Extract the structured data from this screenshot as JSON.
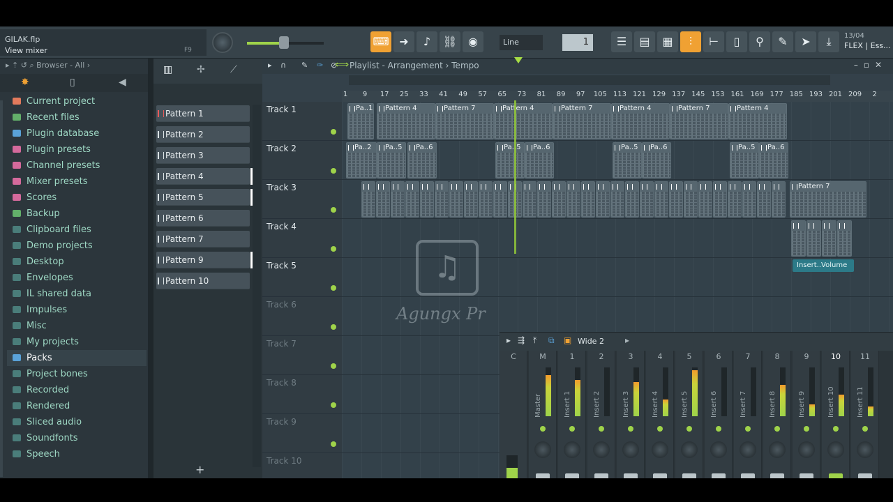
{
  "topbar": {
    "file_name": "GILAK.flp",
    "hint": "View mixer",
    "hint_key": "F9",
    "snap_mode": "Line",
    "step_value": "1",
    "info_line1": "13/04",
    "info_line2": "FLEX | Ess..."
  },
  "browser": {
    "header": "Browser - All",
    "items": [
      {
        "label": "Current project",
        "color": "#e27a5c",
        "selected": false
      },
      {
        "label": "Recent files",
        "color": "#63b06a",
        "selected": false
      },
      {
        "label": "Plugin database",
        "color": "#5aa2d8",
        "selected": false
      },
      {
        "label": "Plugin presets",
        "color": "#d46a9c",
        "selected": false
      },
      {
        "label": "Channel presets",
        "color": "#d46a9c",
        "selected": false
      },
      {
        "label": "Mixer presets",
        "color": "#d46a9c",
        "selected": false
      },
      {
        "label": "Scores",
        "color": "#d46a9c",
        "selected": false
      },
      {
        "label": "Backup",
        "color": "#63b06a",
        "selected": false
      },
      {
        "label": "Clipboard files",
        "color": "#4a7d7a",
        "selected": false
      },
      {
        "label": "Demo projects",
        "color": "#4a7d7a",
        "selected": false
      },
      {
        "label": "Desktop",
        "color": "#4a7d7a",
        "selected": false
      },
      {
        "label": "Envelopes",
        "color": "#4a7d7a",
        "selected": false
      },
      {
        "label": "IL shared data",
        "color": "#4a7d7a",
        "selected": false
      },
      {
        "label": "Impulses",
        "color": "#4a7d7a",
        "selected": false
      },
      {
        "label": "Misc",
        "color": "#4a7d7a",
        "selected": false
      },
      {
        "label": "My projects",
        "color": "#4a7d7a",
        "selected": false
      },
      {
        "label": "Packs",
        "color": "#5aa2d8",
        "selected": true
      },
      {
        "label": "Project bones",
        "color": "#4a7d7a",
        "selected": false
      },
      {
        "label": "Recorded",
        "color": "#4a7d7a",
        "selected": false
      },
      {
        "label": "Rendered",
        "color": "#4a7d7a",
        "selected": false
      },
      {
        "label": "Sliced audio",
        "color": "#4a7d7a",
        "selected": false
      },
      {
        "label": "Soundfonts",
        "color": "#4a7d7a",
        "selected": false
      },
      {
        "label": "Speech",
        "color": "#4a7d7a",
        "selected": false
      }
    ]
  },
  "patterns": [
    {
      "label": "Pattern 1",
      "active": false,
      "current": true
    },
    {
      "label": "Pattern 2",
      "active": false,
      "current": false
    },
    {
      "label": "Pattern 3",
      "active": false,
      "current": false
    },
    {
      "label": "Pattern 4",
      "active": true,
      "current": false
    },
    {
      "label": "Pattern 5",
      "active": true,
      "current": false
    },
    {
      "label": "Pattern 6",
      "active": false,
      "current": false
    },
    {
      "label": "Pattern 7",
      "active": false,
      "current": false
    },
    {
      "label": "Pattern 9",
      "active": true,
      "current": false
    },
    {
      "label": "Pattern 10",
      "active": false,
      "current": false
    }
  ],
  "playlist": {
    "title": "Playlist - Arrangement",
    "subtitle": "Tempo",
    "ruler": [
      "1",
      "9",
      "17",
      "25",
      "33",
      "41",
      "49",
      "57",
      "65",
      "73",
      "81",
      "89",
      "97",
      "105",
      "113",
      "121",
      "129",
      "137",
      "145",
      "153",
      "161",
      "169",
      "177",
      "185",
      "193",
      "201",
      "209",
      "2"
    ],
    "tracks": [
      {
        "label": "Track 1",
        "dim": false
      },
      {
        "label": "Track 2",
        "dim": false
      },
      {
        "label": "Track 3",
        "dim": false
      },
      {
        "label": "Track 4",
        "dim": false
      },
      {
        "label": "Track 5",
        "dim": false
      },
      {
        "label": "Track 6",
        "dim": true
      },
      {
        "label": "Track 7",
        "dim": true
      },
      {
        "label": "Track 8",
        "dim": true
      },
      {
        "label": "Track 9",
        "dim": true
      },
      {
        "label": "Track 10",
        "dim": true
      }
    ],
    "clips": [
      {
        "track": 0,
        "labels": [
          "Pa..1",
          "Pattern 4",
          "Pattern 7",
          "Pattern 4",
          "Pattern 7",
          "Pattern 4",
          "Pattern 7",
          "Pattern 4"
        ]
      },
      {
        "track": 1,
        "labels": [
          "Pa..2",
          "Pa..5",
          "Pa..6",
          "Pa..5",
          "Pa..6",
          "Pa..5",
          "Pa..6",
          "Pa..5",
          "Pa..6"
        ]
      },
      {
        "track": 2,
        "labels": [
          "Pattern 7"
        ]
      }
    ],
    "automation_label": "Insert..Volume"
  },
  "watermark": {
    "text": "Agungx Pr"
  },
  "mixer": {
    "preset": "Wide 2",
    "channels": [
      {
        "num": "C",
        "name": "",
        "level": 0
      },
      {
        "num": "M",
        "name": "Master",
        "level": 0.85
      },
      {
        "num": "1",
        "name": "Insert 1",
        "level": 0.75
      },
      {
        "num": "2",
        "name": "Insert 2",
        "level": 0
      },
      {
        "num": "3",
        "name": "Insert 3",
        "level": 0.7
      },
      {
        "num": "4",
        "name": "Insert 4",
        "level": 0.35
      },
      {
        "num": "5",
        "name": "Insert 5",
        "level": 0.95
      },
      {
        "num": "6",
        "name": "Insert 6",
        "level": 0
      },
      {
        "num": "7",
        "name": "Insert 7",
        "level": 0
      },
      {
        "num": "8",
        "name": "Insert 8",
        "level": 0.65
      },
      {
        "num": "9",
        "name": "Insert 9",
        "level": 0.25
      },
      {
        "num": "10",
        "name": "Insert 10",
        "level": 0.45,
        "selected": true
      },
      {
        "num": "11",
        "name": "Insert 11",
        "level": 0.2
      }
    ]
  }
}
